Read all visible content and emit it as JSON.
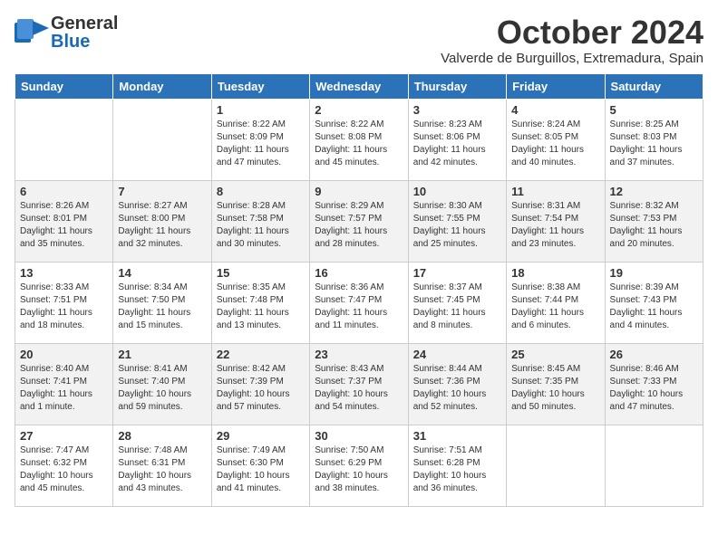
{
  "header": {
    "logo_general": "General",
    "logo_blue": "Blue",
    "title": "October 2024",
    "subtitle": "Valverde de Burguillos, Extremadura, Spain"
  },
  "days_of_week": [
    "Sunday",
    "Monday",
    "Tuesday",
    "Wednesday",
    "Thursday",
    "Friday",
    "Saturday"
  ],
  "weeks": [
    [
      {
        "day": "",
        "sunrise": "",
        "sunset": "",
        "daylight": ""
      },
      {
        "day": "",
        "sunrise": "",
        "sunset": "",
        "daylight": ""
      },
      {
        "day": "1",
        "sunrise": "Sunrise: 8:22 AM",
        "sunset": "Sunset: 8:09 PM",
        "daylight": "Daylight: 11 hours and 47 minutes."
      },
      {
        "day": "2",
        "sunrise": "Sunrise: 8:22 AM",
        "sunset": "Sunset: 8:08 PM",
        "daylight": "Daylight: 11 hours and 45 minutes."
      },
      {
        "day": "3",
        "sunrise": "Sunrise: 8:23 AM",
        "sunset": "Sunset: 8:06 PM",
        "daylight": "Daylight: 11 hours and 42 minutes."
      },
      {
        "day": "4",
        "sunrise": "Sunrise: 8:24 AM",
        "sunset": "Sunset: 8:05 PM",
        "daylight": "Daylight: 11 hours and 40 minutes."
      },
      {
        "day": "5",
        "sunrise": "Sunrise: 8:25 AM",
        "sunset": "Sunset: 8:03 PM",
        "daylight": "Daylight: 11 hours and 37 minutes."
      }
    ],
    [
      {
        "day": "6",
        "sunrise": "Sunrise: 8:26 AM",
        "sunset": "Sunset: 8:01 PM",
        "daylight": "Daylight: 11 hours and 35 minutes."
      },
      {
        "day": "7",
        "sunrise": "Sunrise: 8:27 AM",
        "sunset": "Sunset: 8:00 PM",
        "daylight": "Daylight: 11 hours and 32 minutes."
      },
      {
        "day": "8",
        "sunrise": "Sunrise: 8:28 AM",
        "sunset": "Sunset: 7:58 PM",
        "daylight": "Daylight: 11 hours and 30 minutes."
      },
      {
        "day": "9",
        "sunrise": "Sunrise: 8:29 AM",
        "sunset": "Sunset: 7:57 PM",
        "daylight": "Daylight: 11 hours and 28 minutes."
      },
      {
        "day": "10",
        "sunrise": "Sunrise: 8:30 AM",
        "sunset": "Sunset: 7:55 PM",
        "daylight": "Daylight: 11 hours and 25 minutes."
      },
      {
        "day": "11",
        "sunrise": "Sunrise: 8:31 AM",
        "sunset": "Sunset: 7:54 PM",
        "daylight": "Daylight: 11 hours and 23 minutes."
      },
      {
        "day": "12",
        "sunrise": "Sunrise: 8:32 AM",
        "sunset": "Sunset: 7:53 PM",
        "daylight": "Daylight: 11 hours and 20 minutes."
      }
    ],
    [
      {
        "day": "13",
        "sunrise": "Sunrise: 8:33 AM",
        "sunset": "Sunset: 7:51 PM",
        "daylight": "Daylight: 11 hours and 18 minutes."
      },
      {
        "day": "14",
        "sunrise": "Sunrise: 8:34 AM",
        "sunset": "Sunset: 7:50 PM",
        "daylight": "Daylight: 11 hours and 15 minutes."
      },
      {
        "day": "15",
        "sunrise": "Sunrise: 8:35 AM",
        "sunset": "Sunset: 7:48 PM",
        "daylight": "Daylight: 11 hours and 13 minutes."
      },
      {
        "day": "16",
        "sunrise": "Sunrise: 8:36 AM",
        "sunset": "Sunset: 7:47 PM",
        "daylight": "Daylight: 11 hours and 11 minutes."
      },
      {
        "day": "17",
        "sunrise": "Sunrise: 8:37 AM",
        "sunset": "Sunset: 7:45 PM",
        "daylight": "Daylight: 11 hours and 8 minutes."
      },
      {
        "day": "18",
        "sunrise": "Sunrise: 8:38 AM",
        "sunset": "Sunset: 7:44 PM",
        "daylight": "Daylight: 11 hours and 6 minutes."
      },
      {
        "day": "19",
        "sunrise": "Sunrise: 8:39 AM",
        "sunset": "Sunset: 7:43 PM",
        "daylight": "Daylight: 11 hours and 4 minutes."
      }
    ],
    [
      {
        "day": "20",
        "sunrise": "Sunrise: 8:40 AM",
        "sunset": "Sunset: 7:41 PM",
        "daylight": "Daylight: 11 hours and 1 minute."
      },
      {
        "day": "21",
        "sunrise": "Sunrise: 8:41 AM",
        "sunset": "Sunset: 7:40 PM",
        "daylight": "Daylight: 10 hours and 59 minutes."
      },
      {
        "day": "22",
        "sunrise": "Sunrise: 8:42 AM",
        "sunset": "Sunset: 7:39 PM",
        "daylight": "Daylight: 10 hours and 57 minutes."
      },
      {
        "day": "23",
        "sunrise": "Sunrise: 8:43 AM",
        "sunset": "Sunset: 7:37 PM",
        "daylight": "Daylight: 10 hours and 54 minutes."
      },
      {
        "day": "24",
        "sunrise": "Sunrise: 8:44 AM",
        "sunset": "Sunset: 7:36 PM",
        "daylight": "Daylight: 10 hours and 52 minutes."
      },
      {
        "day": "25",
        "sunrise": "Sunrise: 8:45 AM",
        "sunset": "Sunset: 7:35 PM",
        "daylight": "Daylight: 10 hours and 50 minutes."
      },
      {
        "day": "26",
        "sunrise": "Sunrise: 8:46 AM",
        "sunset": "Sunset: 7:33 PM",
        "daylight": "Daylight: 10 hours and 47 minutes."
      }
    ],
    [
      {
        "day": "27",
        "sunrise": "Sunrise: 7:47 AM",
        "sunset": "Sunset: 6:32 PM",
        "daylight": "Daylight: 10 hours and 45 minutes."
      },
      {
        "day": "28",
        "sunrise": "Sunrise: 7:48 AM",
        "sunset": "Sunset: 6:31 PM",
        "daylight": "Daylight: 10 hours and 43 minutes."
      },
      {
        "day": "29",
        "sunrise": "Sunrise: 7:49 AM",
        "sunset": "Sunset: 6:30 PM",
        "daylight": "Daylight: 10 hours and 41 minutes."
      },
      {
        "day": "30",
        "sunrise": "Sunrise: 7:50 AM",
        "sunset": "Sunset: 6:29 PM",
        "daylight": "Daylight: 10 hours and 38 minutes."
      },
      {
        "day": "31",
        "sunrise": "Sunrise: 7:51 AM",
        "sunset": "Sunset: 6:28 PM",
        "daylight": "Daylight: 10 hours and 36 minutes."
      },
      {
        "day": "",
        "sunrise": "",
        "sunset": "",
        "daylight": ""
      },
      {
        "day": "",
        "sunrise": "",
        "sunset": "",
        "daylight": ""
      }
    ]
  ]
}
